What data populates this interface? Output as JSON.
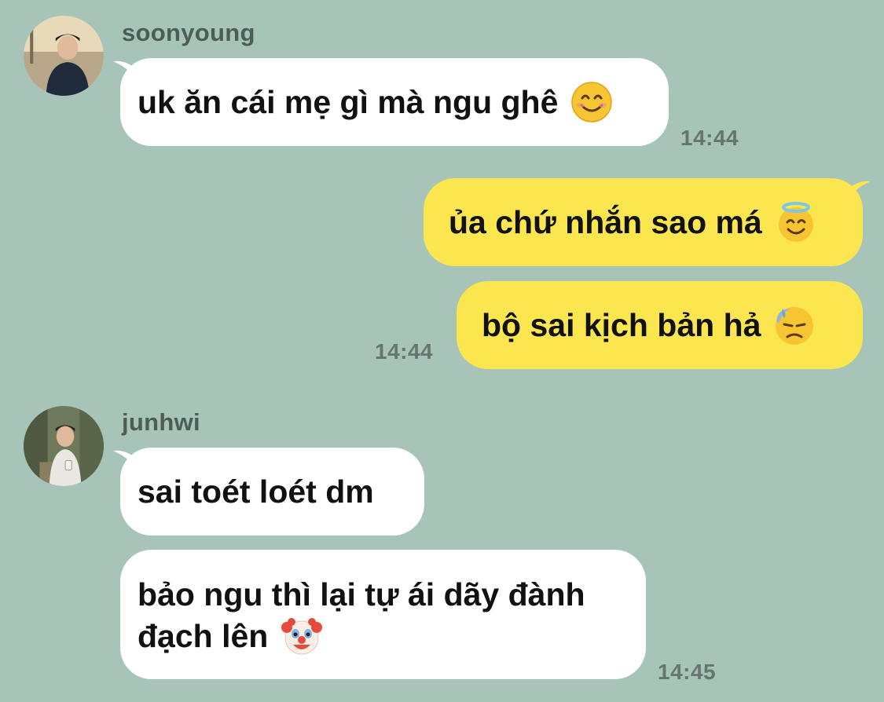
{
  "messages": [
    {
      "sender": "soonyoung",
      "text": "uk ăn cái mẹ gì mà ngu ghê",
      "emoji": "smiling-face-icon",
      "time": "14:44"
    },
    {
      "sender": "me",
      "text": "ủa chứ nhắn sao má",
      "emoji": "halo-face-icon"
    },
    {
      "sender": "me",
      "text": "bộ sai kịch bản hả",
      "emoji": "downcast-sweat-face-icon",
      "time": "14:44"
    },
    {
      "sender": "junhwi",
      "text": "sai toét loét dm"
    },
    {
      "sender": "junhwi",
      "text_line1": "bảo ngu thì lại tự ái dãy đành",
      "text_line2": "đạch lên",
      "emoji": "clown-face-icon",
      "time": "14:45"
    }
  ],
  "colors": {
    "background": "#a6c4b7",
    "incoming_bubble": "#ffffff",
    "outgoing_bubble": "#fbe64f",
    "sender_name": "#4e5c57",
    "timestamp": "#66756f"
  }
}
